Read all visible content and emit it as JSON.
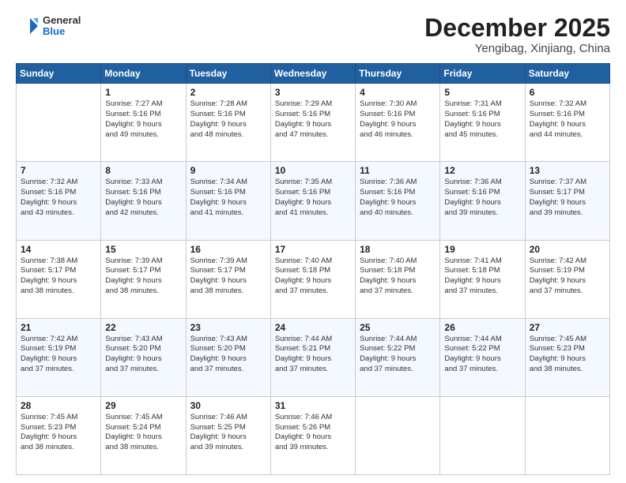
{
  "logo": {
    "general": "General",
    "blue": "Blue"
  },
  "header": {
    "month": "December 2025",
    "location": "Yengibag, Xinjiang, China"
  },
  "weekdays": [
    "Sunday",
    "Monday",
    "Tuesday",
    "Wednesday",
    "Thursday",
    "Friday",
    "Saturday"
  ],
  "weeks": [
    [
      {
        "day": "",
        "info": ""
      },
      {
        "day": "1",
        "info": "Sunrise: 7:27 AM\nSunset: 5:16 PM\nDaylight: 9 hours\nand 49 minutes."
      },
      {
        "day": "2",
        "info": "Sunrise: 7:28 AM\nSunset: 5:16 PM\nDaylight: 9 hours\nand 48 minutes."
      },
      {
        "day": "3",
        "info": "Sunrise: 7:29 AM\nSunset: 5:16 PM\nDaylight: 9 hours\nand 47 minutes."
      },
      {
        "day": "4",
        "info": "Sunrise: 7:30 AM\nSunset: 5:16 PM\nDaylight: 9 hours\nand 46 minutes."
      },
      {
        "day": "5",
        "info": "Sunrise: 7:31 AM\nSunset: 5:16 PM\nDaylight: 9 hours\nand 45 minutes."
      },
      {
        "day": "6",
        "info": "Sunrise: 7:32 AM\nSunset: 5:16 PM\nDaylight: 9 hours\nand 44 minutes."
      }
    ],
    [
      {
        "day": "7",
        "info": "Sunrise: 7:32 AM\nSunset: 5:16 PM\nDaylight: 9 hours\nand 43 minutes."
      },
      {
        "day": "8",
        "info": "Sunrise: 7:33 AM\nSunset: 5:16 PM\nDaylight: 9 hours\nand 42 minutes."
      },
      {
        "day": "9",
        "info": "Sunrise: 7:34 AM\nSunset: 5:16 PM\nDaylight: 9 hours\nand 41 minutes."
      },
      {
        "day": "10",
        "info": "Sunrise: 7:35 AM\nSunset: 5:16 PM\nDaylight: 9 hours\nand 41 minutes."
      },
      {
        "day": "11",
        "info": "Sunrise: 7:36 AM\nSunset: 5:16 PM\nDaylight: 9 hours\nand 40 minutes."
      },
      {
        "day": "12",
        "info": "Sunrise: 7:36 AM\nSunset: 5:16 PM\nDaylight: 9 hours\nand 39 minutes."
      },
      {
        "day": "13",
        "info": "Sunrise: 7:37 AM\nSunset: 5:17 PM\nDaylight: 9 hours\nand 39 minutes."
      }
    ],
    [
      {
        "day": "14",
        "info": "Sunrise: 7:38 AM\nSunset: 5:17 PM\nDaylight: 9 hours\nand 38 minutes."
      },
      {
        "day": "15",
        "info": "Sunrise: 7:39 AM\nSunset: 5:17 PM\nDaylight: 9 hours\nand 38 minutes."
      },
      {
        "day": "16",
        "info": "Sunrise: 7:39 AM\nSunset: 5:17 PM\nDaylight: 9 hours\nand 38 minutes."
      },
      {
        "day": "17",
        "info": "Sunrise: 7:40 AM\nSunset: 5:18 PM\nDaylight: 9 hours\nand 37 minutes."
      },
      {
        "day": "18",
        "info": "Sunrise: 7:40 AM\nSunset: 5:18 PM\nDaylight: 9 hours\nand 37 minutes."
      },
      {
        "day": "19",
        "info": "Sunrise: 7:41 AM\nSunset: 5:18 PM\nDaylight: 9 hours\nand 37 minutes."
      },
      {
        "day": "20",
        "info": "Sunrise: 7:42 AM\nSunset: 5:19 PM\nDaylight: 9 hours\nand 37 minutes."
      }
    ],
    [
      {
        "day": "21",
        "info": "Sunrise: 7:42 AM\nSunset: 5:19 PM\nDaylight: 9 hours\nand 37 minutes."
      },
      {
        "day": "22",
        "info": "Sunrise: 7:43 AM\nSunset: 5:20 PM\nDaylight: 9 hours\nand 37 minutes."
      },
      {
        "day": "23",
        "info": "Sunrise: 7:43 AM\nSunset: 5:20 PM\nDaylight: 9 hours\nand 37 minutes."
      },
      {
        "day": "24",
        "info": "Sunrise: 7:44 AM\nSunset: 5:21 PM\nDaylight: 9 hours\nand 37 minutes."
      },
      {
        "day": "25",
        "info": "Sunrise: 7:44 AM\nSunset: 5:22 PM\nDaylight: 9 hours\nand 37 minutes."
      },
      {
        "day": "26",
        "info": "Sunrise: 7:44 AM\nSunset: 5:22 PM\nDaylight: 9 hours\nand 37 minutes."
      },
      {
        "day": "27",
        "info": "Sunrise: 7:45 AM\nSunset: 5:23 PM\nDaylight: 9 hours\nand 38 minutes."
      }
    ],
    [
      {
        "day": "28",
        "info": "Sunrise: 7:45 AM\nSunset: 5:23 PM\nDaylight: 9 hours\nand 38 minutes."
      },
      {
        "day": "29",
        "info": "Sunrise: 7:45 AM\nSunset: 5:24 PM\nDaylight: 9 hours\nand 38 minutes."
      },
      {
        "day": "30",
        "info": "Sunrise: 7:46 AM\nSunset: 5:25 PM\nDaylight: 9 hours\nand 39 minutes."
      },
      {
        "day": "31",
        "info": "Sunrise: 7:46 AM\nSunset: 5:26 PM\nDaylight: 9 hours\nand 39 minutes."
      },
      {
        "day": "",
        "info": ""
      },
      {
        "day": "",
        "info": ""
      },
      {
        "day": "",
        "info": ""
      }
    ]
  ]
}
